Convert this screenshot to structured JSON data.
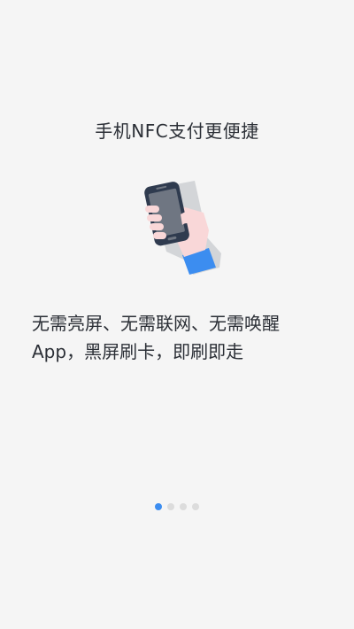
{
  "slide": {
    "title": "手机NFC支付更便捷",
    "description_lines": [
      "无需亮屏、无需联网、无需唤醒",
      "App，黑屏刷卡，即刷即走"
    ]
  },
  "pager": {
    "total": 4,
    "active_index": 0,
    "active_color": "#3c8df0",
    "inactive_color": "#dcdcdc"
  },
  "illustration": {
    "icon": "hand-holding-phone-icon",
    "colors": {
      "phone_body": "#2f3b4f",
      "phone_screen": "#6f7682",
      "hand": "#f9d7d8",
      "sleeve": "#3c8df0",
      "shadow": "#d3d5d8"
    }
  }
}
